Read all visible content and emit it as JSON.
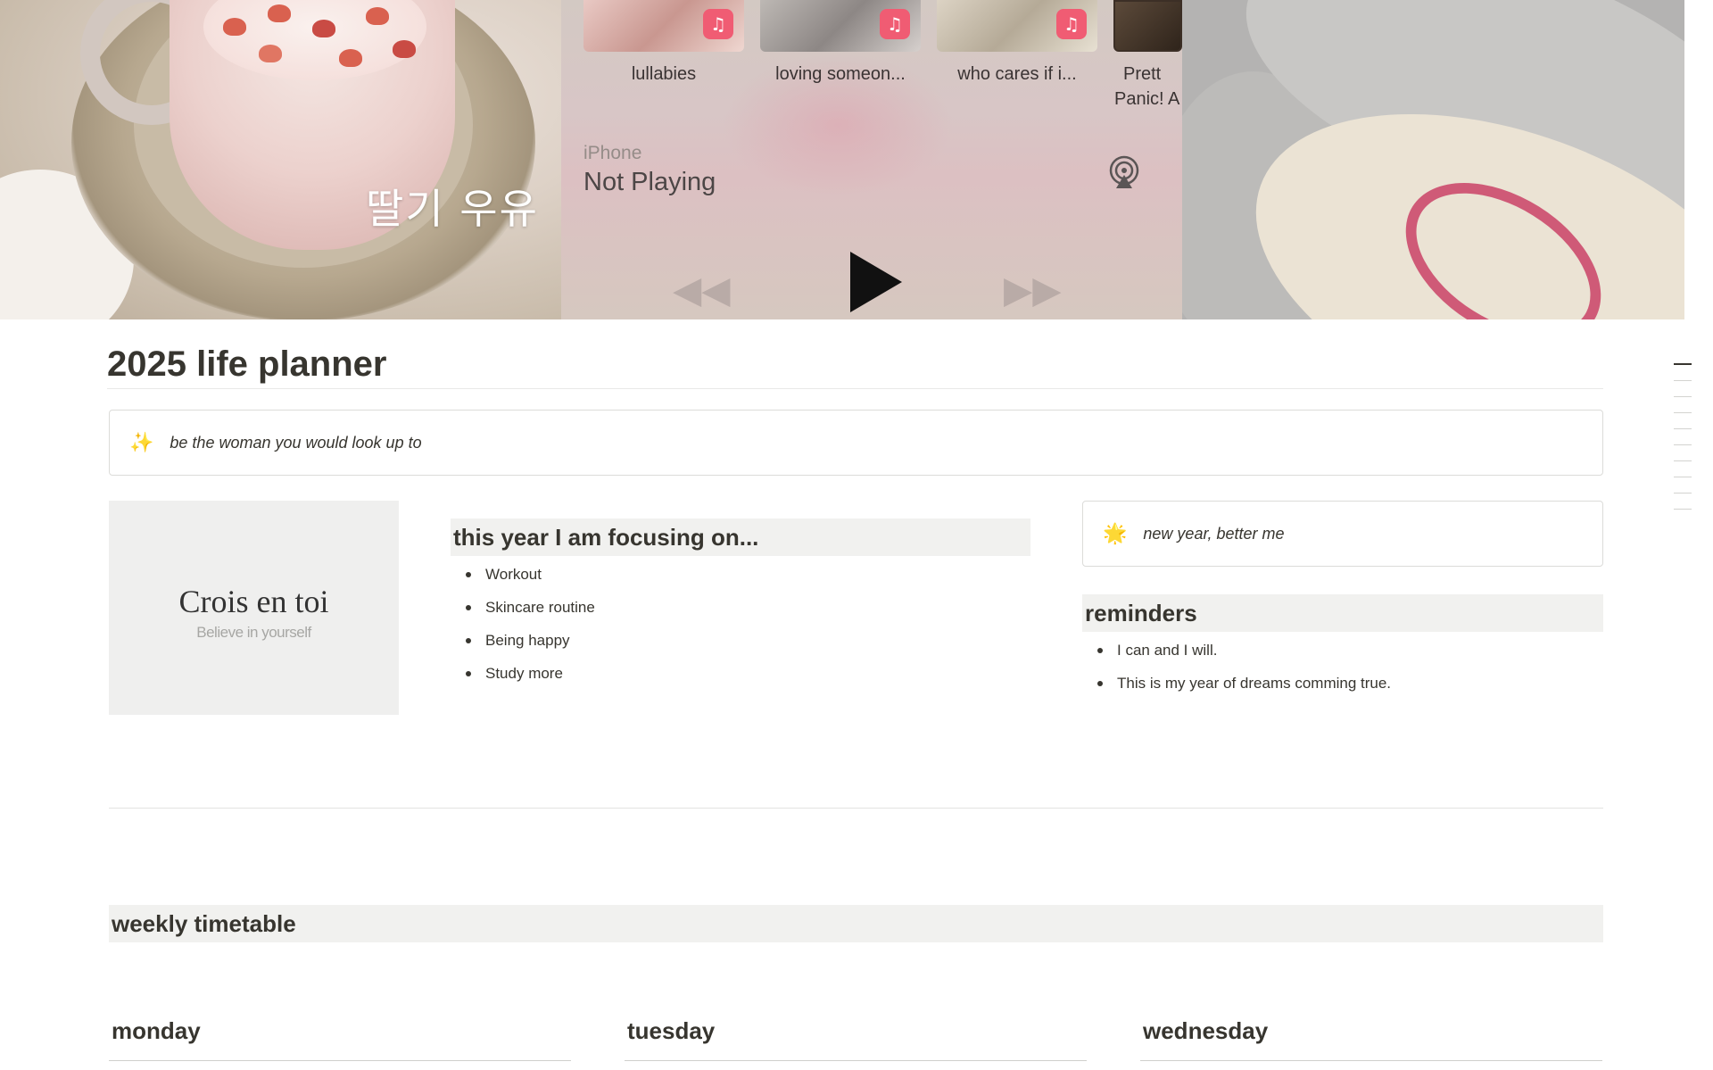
{
  "cover": {
    "korean_text": "딸기 우유",
    "music_widget": {
      "albums": [
        {
          "title": "lullabies"
        },
        {
          "title": "loving someon..."
        },
        {
          "title": "who cares if i..."
        },
        {
          "title": "Prett",
          "subtitle": "Panic! A"
        }
      ],
      "device": "iPhone",
      "status": "Not Playing",
      "icons": [
        "music-note-icon",
        "airplay-icon",
        "rewind-icon",
        "play-icon",
        "fast-forward-icon"
      ]
    }
  },
  "page": {
    "title": "2025 life planner",
    "quote_callout": {
      "emoji": "✨",
      "text": "be the woman you would look up to"
    },
    "crois_card": {
      "title": "Crois en toi",
      "subtitle": "Believe in yourself"
    },
    "focus": {
      "heading": "this year I am focusing on...",
      "items": [
        "Workout",
        "Skincare routine",
        "Being happy",
        "Study more"
      ]
    },
    "new_year_callout": {
      "emoji": "🌟",
      "text": "new year, better me"
    },
    "reminders": {
      "heading": "reminders",
      "items": [
        "I can and I will.",
        "This is my year of dreams comming true."
      ]
    },
    "weekly": {
      "heading": "weekly timetable",
      "days": [
        "monday",
        "tuesday",
        "wednesday"
      ]
    }
  },
  "colors": {
    "text": "#37352f",
    "heading_bg": "#f1f1ef",
    "card_bg": "#efefee",
    "music_badge": "#f05c73",
    "sock_accent": "#cf5a77"
  }
}
